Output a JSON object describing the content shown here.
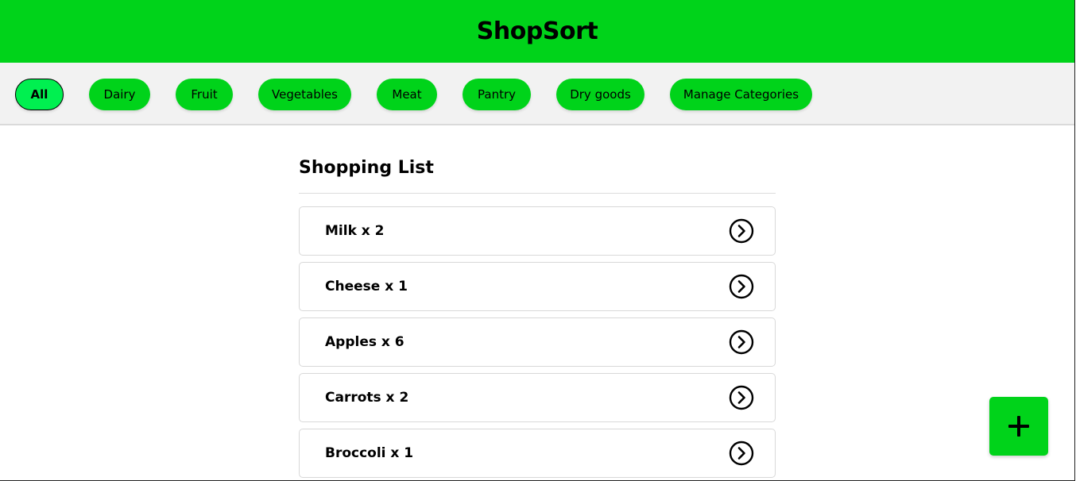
{
  "header": {
    "title": "ShopSort"
  },
  "categories": {
    "items": [
      {
        "label": "All",
        "active": true
      },
      {
        "label": "Dairy"
      },
      {
        "label": "Fruit"
      },
      {
        "label": "Vegetables"
      },
      {
        "label": "Meat"
      },
      {
        "label": "Pantry"
      },
      {
        "label": "Dry goods"
      },
      {
        "label": "Manage Categories"
      }
    ]
  },
  "shopping_list": {
    "title": "Shopping List",
    "items": [
      {
        "label": "Milk x 2"
      },
      {
        "label": "Cheese x 1"
      },
      {
        "label": "Apples x 6"
      },
      {
        "label": "Carrots x 2"
      },
      {
        "label": "Broccoli x 1"
      }
    ]
  },
  "fab": {
    "icon": "plus-icon"
  },
  "colors": {
    "brand_green": "#00d31a",
    "active_chip": "#00f050",
    "category_bar": "#f2f2f2"
  }
}
